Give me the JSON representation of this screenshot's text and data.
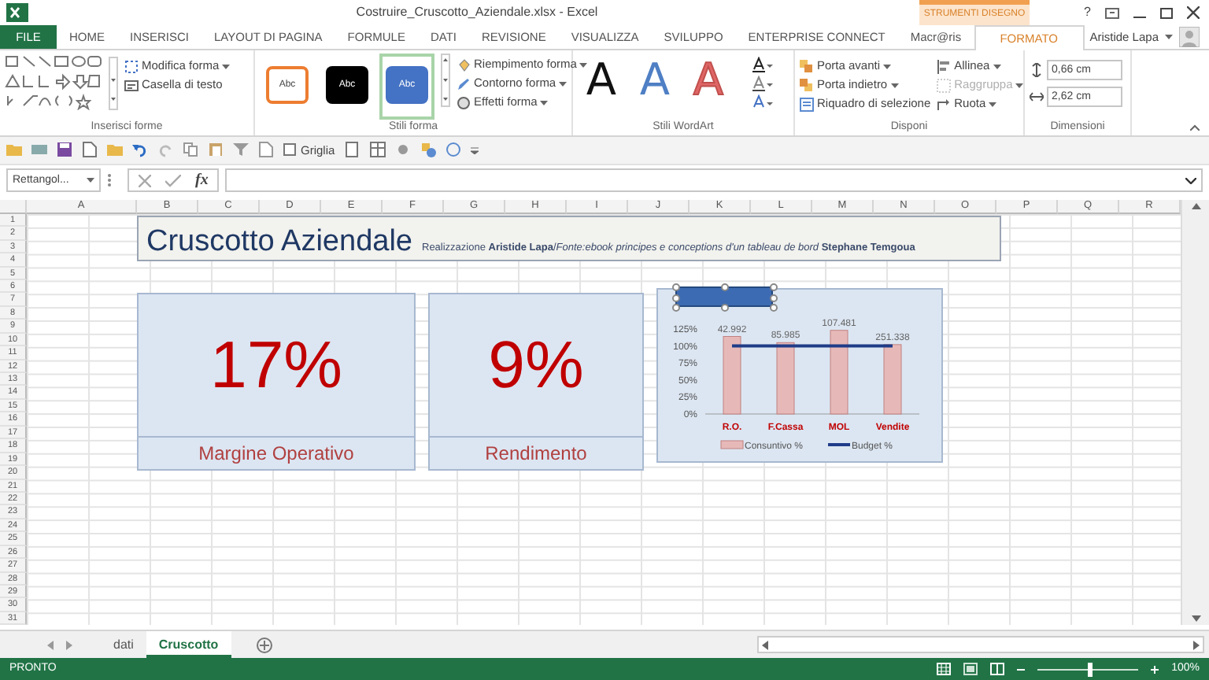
{
  "window": {
    "title": "Costruire_Cruscotto_Aziendale.xlsx - Excel",
    "context_label": "STRUMENTI DISEGNO",
    "help": "?",
    "user": "Aristide Lapa"
  },
  "ribbon_tabs": [
    {
      "label": "FILE",
      "kind": "file",
      "selected": false
    },
    {
      "label": "HOME",
      "kind": "tab",
      "selected": false
    },
    {
      "label": "INSERISCI",
      "kind": "tab",
      "selected": false
    },
    {
      "label": "LAYOUT DI PAGINA",
      "kind": "tab",
      "selected": false
    },
    {
      "label": "FORMULE",
      "kind": "tab",
      "selected": false
    },
    {
      "label": "DATI",
      "kind": "tab",
      "selected": false
    },
    {
      "label": "REVISIONE",
      "kind": "tab",
      "selected": false
    },
    {
      "label": "VISUALIZZA",
      "kind": "tab",
      "selected": false
    },
    {
      "label": "SVILUPPO",
      "kind": "tab",
      "selected": false
    },
    {
      "label": "ENTERPRISE CONNECT",
      "kind": "tab",
      "selected": false
    },
    {
      "label": "Macr@ris",
      "kind": "tab",
      "selected": false
    },
    {
      "label": "FORMATO",
      "kind": "tab",
      "selected": true
    }
  ],
  "ribbon": {
    "insert_shapes": {
      "label": "Inserisci forme",
      "commands": [
        "Modifica forma",
        "Casella di testo"
      ]
    },
    "shape_styles": {
      "label": "Stili forma",
      "swatches": [
        {
          "text": "Abc",
          "color": "#ed7d31",
          "selected": false
        },
        {
          "text": "Abc",
          "color": "#000000",
          "selected": false
        },
        {
          "text": "Abc",
          "color": "#4472c4",
          "selected": true
        }
      ],
      "commands": [
        "Riempimento forma",
        "Contorno forma",
        "Effetti forma"
      ]
    },
    "wordart_styles": {
      "label": "Stili WordArt",
      "samples": [
        {
          "text": "A",
          "color": "#111111"
        },
        {
          "text": "A",
          "color": "#4f7fc4"
        },
        {
          "text": "A",
          "color": "#e06666"
        }
      ]
    },
    "arrange": {
      "label": "Disponi",
      "commands": [
        {
          "label": "Porta avanti",
          "disabled": false
        },
        {
          "label": "Porta indietro",
          "disabled": false
        },
        {
          "label": "Riquadro di selezione",
          "disabled": false
        },
        {
          "label": "Allinea",
          "disabled": false
        },
        {
          "label": "Raggruppa",
          "disabled": true
        },
        {
          "label": "Ruota",
          "disabled": false
        }
      ]
    },
    "size": {
      "label": "Dimensioni",
      "height": "0,66 cm",
      "width": "2,62 cm"
    }
  },
  "quick_access": {
    "gridlines": {
      "label": "Griglia",
      "checked": false
    }
  },
  "formula_bar": {
    "name_box": "Rettangol...",
    "function_label": "fx"
  },
  "columns": [
    "A",
    "B",
    "C",
    "D",
    "E",
    "F",
    "G",
    "H",
    "I",
    "J",
    "K",
    "L",
    "M",
    "N",
    "O",
    "P",
    "Q",
    "R"
  ],
  "rows": [
    "1",
    "2",
    "3",
    "4",
    "5",
    "6",
    "7",
    "8",
    "9",
    "10",
    "11",
    "12",
    "13",
    "14",
    "15",
    "16",
    "17",
    "18",
    "19",
    "20",
    "21",
    "22",
    "23",
    "24",
    "25",
    "26",
    "27",
    "28",
    "29",
    "30",
    "31"
  ],
  "dashboard": {
    "title": "Cruscotto Aziendale",
    "subtitle": "Realizzazione **Aristide Lapa**/*Fonte:ebook  principes e conceptions d'un tableau de bord* **Stephane Temgoua**",
    "kpis": [
      {
        "value": "17%",
        "label": "Margine Operativo"
      },
      {
        "value": "9%",
        "label": "Rendimento"
      }
    ],
    "chart": {
      "chart_data": {
        "type": "bar",
        "categories": [
          "R.O.",
          "F.Cassa",
          "MOL",
          "Vendite"
        ],
        "ylim": [
          0,
          125
        ],
        "yticks": [
          {
            "value": 0,
            "label": "0%"
          },
          {
            "value": 25,
            "label": "25%"
          },
          {
            "value": 50,
            "label": "50%"
          },
          {
            "value": 75,
            "label": "75%"
          },
          {
            "value": 100,
            "label": "100%"
          },
          {
            "value": 125,
            "label": "125%"
          }
        ],
        "series": [
          {
            "name": "Consuntivo %",
            "color": "#e6b9b8",
            "type": "bar",
            "values": [
              114,
              105,
              123,
              102
            ]
          },
          {
            "name": "Budget %",
            "color": "#1f3c88",
            "type": "line",
            "values": [
              100,
              100,
              100,
              100
            ]
          }
        ],
        "value_labels": [
          "42.992",
          "85.985",
          "107.481",
          "251.338"
        ],
        "legend": "bottom"
      }
    }
  },
  "sheet_tabs": [
    {
      "label": "dati",
      "selected": false
    },
    {
      "label": "Cruscotto",
      "selected": true
    }
  ],
  "status_bar": {
    "state": "PRONTO",
    "zoom": "100%",
    "zoom_slider": {
      "level": 0.5
    }
  }
}
